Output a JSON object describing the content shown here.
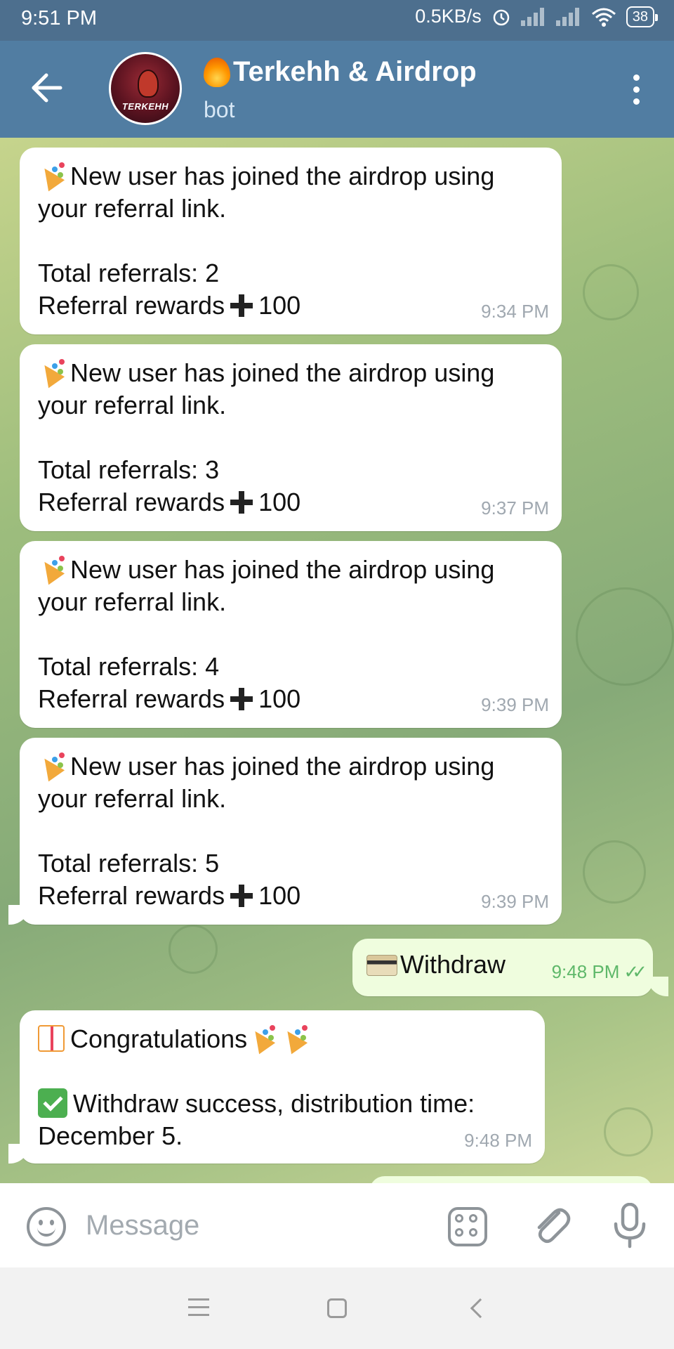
{
  "status_bar": {
    "time": "9:51 PM",
    "network_speed": "0.5KB/s",
    "battery": "38"
  },
  "header": {
    "title": "Terkehh & Airdrop",
    "subtitle": "bot",
    "avatar_text": "TERKEHH"
  },
  "messages": [
    {
      "direction": "in",
      "lines": [
        "New user has joined the airdrop using",
        "your referral link.",
        "",
        "Total referrals: 2",
        "Referral rewards"
      ],
      "reward": "100",
      "time": "9:34 PM"
    },
    {
      "direction": "in",
      "lines": [
        "New user has joined the airdrop using",
        "your referral link.",
        "",
        "Total referrals: 3",
        "Referral rewards"
      ],
      "reward": "100",
      "time": "9:37 PM"
    },
    {
      "direction": "in",
      "lines": [
        "New user has joined the airdrop using",
        "your referral link.",
        "",
        "Total referrals: 4",
        "Referral rewards"
      ],
      "reward": "100",
      "time": "9:39 PM"
    },
    {
      "direction": "in",
      "lines": [
        "New user has joined the airdrop using",
        "your referral link.",
        "",
        "Total referrals: 5",
        "Referral rewards"
      ],
      "reward": "100",
      "time": "9:39 PM"
    },
    {
      "direction": "out",
      "text": "Withdraw",
      "time": "9:48 PM",
      "status": "read"
    },
    {
      "direction": "in",
      "line1": "Congratulations",
      "line2": "Withdraw success, distribution time:",
      "line3": "December 5.",
      "time": "9:48 PM"
    }
  ],
  "input": {
    "placeholder": "Message"
  },
  "icons": {
    "back": "arrow-left-icon",
    "menu": "more-vertical-icon",
    "emoji": "emoji-icon",
    "apps": "bot-menu-icon",
    "attach": "paperclip-icon",
    "mic": "microphone-icon"
  },
  "colors": {
    "header": "#517da2",
    "status_bar": "#4d6f8e",
    "incoming_bubble": "#ffffff",
    "outgoing_bubble": "#effdde",
    "read_ticks": "#5fb86a"
  }
}
